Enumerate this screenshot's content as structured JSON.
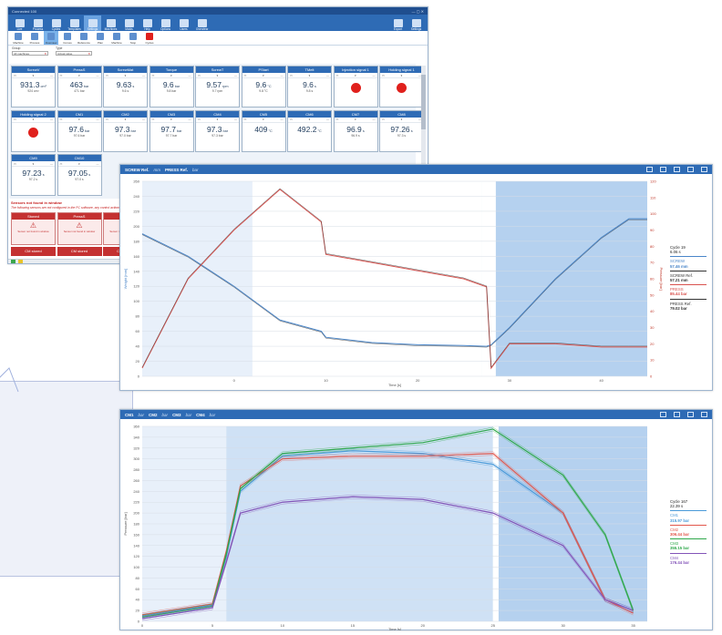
{
  "main": {
    "title": "Connected 100",
    "ribbon": [
      "Live",
      "Process",
      "Cycles",
      "Templates",
      "Settings",
      "Machines",
      "Molds",
      "Help",
      "Options",
      "Users",
      "Overview",
      "Export",
      "Settings"
    ],
    "subbar": [
      "Machine",
      "Process",
      "Overview",
      "Curves",
      "Reference",
      "Plan",
      "Machine",
      "Stop",
      "Cycles"
    ],
    "filters": {
      "label1": "Group",
      "value1": "All machines",
      "label2": "Type",
      "value2": "Actual value"
    },
    "cards": [
      {
        "title": "ScrewV",
        "value": "931.3",
        "unit": "cm³",
        "sub": "924 cm³"
      },
      {
        "title": "PressS",
        "value": "463",
        "unit": "bar",
        "sub": "471 bar"
      },
      {
        "title": "ScrewMat",
        "value": "9.63",
        "unit": "s",
        "sub": "9.6 s"
      },
      {
        "title": "Torque",
        "value": "9.6",
        "unit": "bar",
        "sub": "9.8 bar"
      },
      {
        "title": "ScrewT",
        "value": "9.57",
        "unit": "rpm",
        "sub": "9.7 rpm"
      },
      {
        "title": "PStart",
        "value": "9.6",
        "unit": "°C",
        "sub": "9.8 °C"
      },
      {
        "title": "TMelt",
        "value": "9.6",
        "unit": "s",
        "sub": "9.8 s"
      },
      {
        "title": "Injection signal 1",
        "value": "",
        "unit": "",
        "sub": ""
      },
      {
        "title": "Holding signal 1",
        "value": "",
        "unit": "",
        "sub": ""
      },
      {
        "title": "Holding signal 2",
        "value": "",
        "unit": "",
        "sub": ""
      },
      {
        "title": "CM1",
        "value": "97.6",
        "unit": "bar",
        "sub": "97.6 bar"
      },
      {
        "title": "CM2",
        "value": "97.3",
        "unit": "bar",
        "sub": "97.0 bar"
      },
      {
        "title": "CM3",
        "value": "97.7",
        "unit": "bar",
        "sub": "97.7 bar"
      },
      {
        "title": "CM4",
        "value": "97.3",
        "unit": "bar",
        "sub": "97.3 bar"
      },
      {
        "title": "CM5",
        "value": "409",
        "unit": "°C",
        "sub": ""
      },
      {
        "title": "CM6",
        "value": "492.2",
        "unit": "°C",
        "sub": ""
      },
      {
        "title": "CM7",
        "value": "96.9",
        "unit": "s",
        "sub": "96.9 s"
      },
      {
        "title": "CM8",
        "value": "97.26",
        "unit": "s",
        "sub": "97.3 s"
      },
      {
        "title": "CM9",
        "value": "97.23",
        "unit": "s",
        "sub": "97.2 s"
      },
      {
        "title": "CM10",
        "value": "97.05",
        "unit": "s",
        "sub": "97.0 s"
      }
    ],
    "alert_title": "Sensors not found in window",
    "alert_sub": "The following sensors are not configured in the PC software, any control actions must be done in the machine",
    "red_cards": [
      {
        "title": "Stoned",
        "msg": "Sensor not found in window"
      },
      {
        "title": "PressS",
        "msg": "Sensor not found in window"
      },
      {
        "title": "Press",
        "msg": "Sensor not found in window"
      }
    ],
    "red_bottom": [
      "CM stored",
      "CM stored",
      "CM stored"
    ]
  },
  "chart1": {
    "header": [
      {
        "name": "SCREW Ref.",
        "unit": "mm"
      },
      {
        "name": "PRESS Ref.",
        "unit": "bar"
      }
    ],
    "legend": {
      "cycle_label": "Cycle 19",
      "cycle_time": "6.06 s",
      "items": [
        {
          "label": "SCREW",
          "value": "57.46 mm",
          "color": "#4a86c9"
        },
        {
          "label": "SCREW Ref.",
          "value": "57.21 mm",
          "color": "#333333"
        },
        {
          "label": "PRESS",
          "value": "85.44 bar",
          "color": "#d9534f"
        },
        {
          "label": "PRESS Ref.",
          "value": "79.02 bar",
          "color": "#333333"
        }
      ]
    },
    "y_label": "Weight [mm]",
    "y2_label": "Pressure [bar]",
    "x_label": "Time [s]"
  },
  "chart2": {
    "header": [
      {
        "name": "CM1",
        "unit": "bar"
      },
      {
        "name": "CM2",
        "unit": "bar"
      },
      {
        "name": "CM3",
        "unit": "bar"
      },
      {
        "name": "CM4",
        "unit": "bar"
      }
    ],
    "legend": {
      "cycle_label": "Cycle 167",
      "cycle_time": "22.39 s",
      "items": [
        {
          "label": "CM1",
          "value": "315.97 bar",
          "color": "#4a9ad9"
        },
        {
          "label": "CM2",
          "value": "306.44 bar",
          "color": "#e2574c"
        },
        {
          "label": "CM3",
          "value": "355.15 bar",
          "color": "#2ea84a"
        },
        {
          "label": "CM4",
          "value": "176.44 bar",
          "color": "#8253b8"
        }
      ]
    },
    "y_label": "Pressure [bar]",
    "x_label": "Time [s]"
  },
  "chart_data": [
    {
      "type": "line",
      "x": [
        -10,
        -5,
        0,
        5,
        9.5,
        10,
        15,
        20,
        25,
        27.5,
        28,
        30,
        35,
        40,
        43,
        45
      ],
      "series": [
        {
          "name": "SCREW",
          "values": [
            190,
            160,
            120,
            75,
            60,
            52,
            45,
            42,
            41,
            40,
            42,
            65,
            130,
            185,
            210,
            210
          ]
        },
        {
          "name": "PRESS",
          "values": [
            5,
            60,
            90,
            115,
            95,
            75,
            70,
            65,
            60,
            55,
            5,
            20,
            20,
            18,
            18,
            18
          ]
        }
      ],
      "xlim": [
        -10,
        45
      ],
      "ylim": [
        0,
        260
      ],
      "y2lim": [
        0,
        120
      ],
      "x_ticks": [
        0,
        10,
        20,
        30,
        40
      ],
      "y_ticks": [
        0,
        20,
        40,
        60,
        80,
        100,
        120,
        140,
        160,
        180,
        200,
        220,
        240,
        260
      ],
      "y2_ticks": [
        0,
        10,
        20,
        30,
        40,
        50,
        60,
        70,
        80,
        90,
        100,
        110,
        120
      ]
    },
    {
      "type": "line",
      "x": [
        0,
        5,
        6,
        7,
        10,
        15,
        20,
        25,
        30,
        33,
        35
      ],
      "series": [
        {
          "name": "CM1",
          "values": [
            10,
            30,
            120,
            240,
            305,
            315,
            310,
            290,
            200,
            40,
            20
          ]
        },
        {
          "name": "CM2",
          "values": [
            12,
            32,
            130,
            250,
            300,
            305,
            305,
            310,
            200,
            40,
            15
          ]
        },
        {
          "name": "CM3",
          "values": [
            8,
            28,
            125,
            245,
            310,
            320,
            330,
            355,
            270,
            160,
            20
          ]
        },
        {
          "name": "CM4",
          "values": [
            5,
            25,
            110,
            200,
            220,
            230,
            225,
            200,
            140,
            40,
            20
          ]
        }
      ],
      "xlim": [
        0,
        36
      ],
      "ylim": [
        0,
        360
      ],
      "x_ticks": [
        0,
        5,
        10,
        15,
        20,
        25,
        30,
        35
      ],
      "y_ticks": [
        0,
        20,
        40,
        60,
        80,
        100,
        120,
        140,
        160,
        180,
        200,
        220,
        240,
        260,
        280,
        300,
        320,
        340,
        360
      ]
    }
  ]
}
